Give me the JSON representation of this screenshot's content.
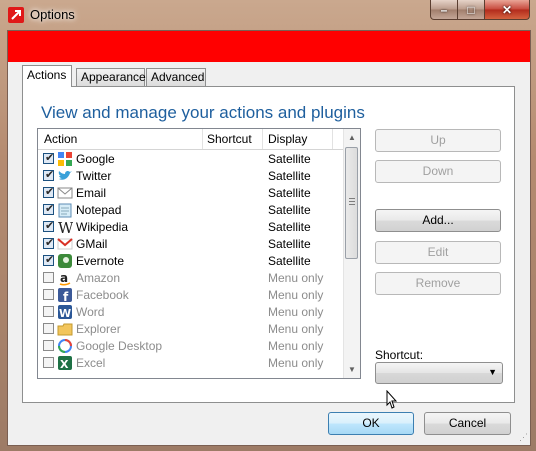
{
  "window": {
    "title": "Options"
  },
  "tabs": [
    {
      "label": "Actions",
      "active": true
    },
    {
      "label": "Appearance",
      "active": false
    },
    {
      "label": "Advanced",
      "active": false
    }
  ],
  "panel": {
    "heading": "View and manage your actions and plugins"
  },
  "list": {
    "columns": [
      "Action",
      "Shortcut",
      "Display"
    ],
    "rows": [
      {
        "name": "Google",
        "checked": true,
        "display": "Satellite",
        "icon": "google-icon"
      },
      {
        "name": "Twitter",
        "checked": true,
        "display": "Satellite",
        "icon": "twitter-icon"
      },
      {
        "name": "Email",
        "checked": true,
        "display": "Satellite",
        "icon": "email-icon"
      },
      {
        "name": "Notepad",
        "checked": true,
        "display": "Satellite",
        "icon": "notepad-icon"
      },
      {
        "name": "Wikipedia",
        "checked": true,
        "display": "Satellite",
        "icon": "wikipedia-icon"
      },
      {
        "name": "GMail",
        "checked": true,
        "display": "Satellite",
        "icon": "gmail-icon"
      },
      {
        "name": "Evernote",
        "checked": true,
        "display": "Satellite",
        "icon": "evernote-icon"
      },
      {
        "name": "Amazon",
        "checked": false,
        "display": "Menu only",
        "icon": "amazon-icon"
      },
      {
        "name": "Facebook",
        "checked": false,
        "display": "Menu only",
        "icon": "facebook-icon"
      },
      {
        "name": "Word",
        "checked": false,
        "display": "Menu only",
        "icon": "word-icon"
      },
      {
        "name": "Explorer",
        "checked": false,
        "display": "Menu only",
        "icon": "explorer-icon"
      },
      {
        "name": "Google Desktop",
        "checked": false,
        "display": "Menu only",
        "icon": "google-desktop-icon"
      },
      {
        "name": "Excel",
        "checked": false,
        "display": "Menu only",
        "icon": "excel-icon"
      }
    ]
  },
  "side_buttons": {
    "up": "Up",
    "down": "Down",
    "add": "Add...",
    "edit": "Edit",
    "remove": "Remove"
  },
  "shortcut": {
    "label": "Shortcut:",
    "value": ""
  },
  "footer": {
    "ok": "OK",
    "cancel": "Cancel"
  },
  "colors": {
    "banner": "#ff0000",
    "heading": "#1e5f9e"
  }
}
